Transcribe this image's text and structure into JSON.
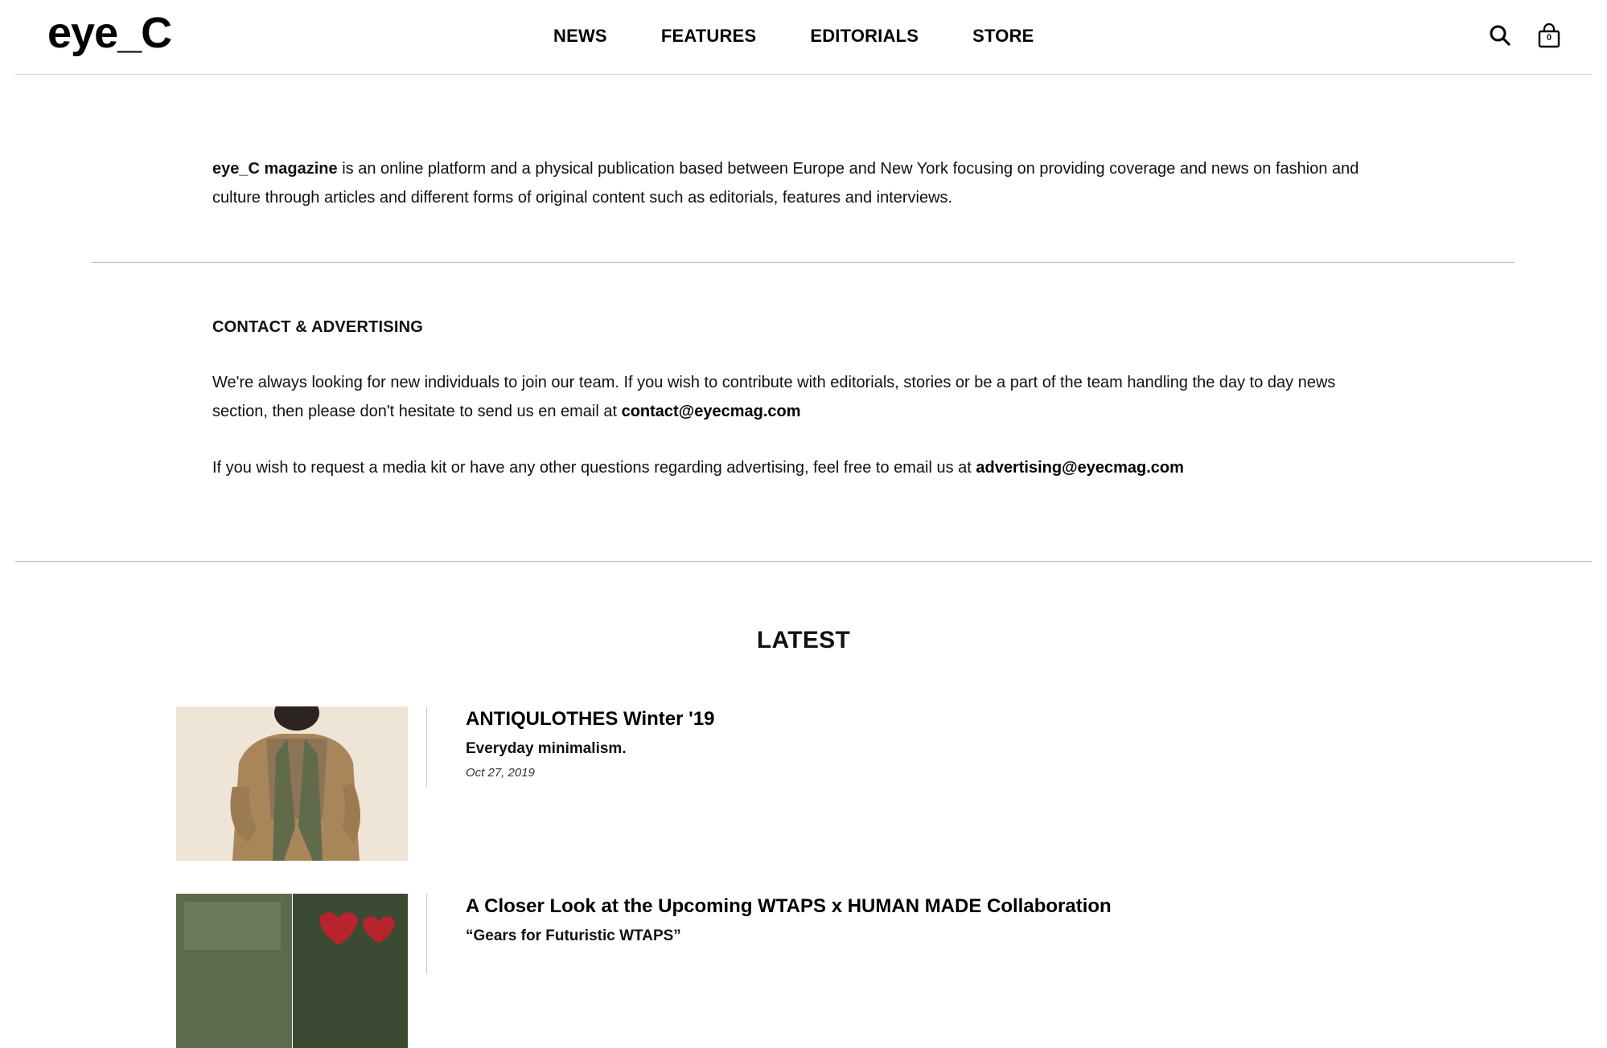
{
  "header": {
    "logo": "eye_C",
    "nav": [
      "NEWS",
      "FEATURES",
      "EDITORIALS",
      "STORE"
    ],
    "search_icon": "search-icon",
    "bag_icon": "shopping-bag-icon",
    "bag_count": "0"
  },
  "about": {
    "brand": "eye_C magazine",
    "text": " is an online platform and a physical publication based between Europe and New York focusing on providing coverage and news on fashion and culture through articles and different forms of original content such as editorials, features and interviews."
  },
  "contact": {
    "title": "CONTACT & ADVERTISING",
    "p1_text": "We're always looking for new individuals to join our team. If you wish to contribute with editorials, stories or be a part of the team handling the day to day news section, then please don't hesitate to send us en email at ",
    "p1_email": "contact@eyecmag.com",
    "p2_text": "If you wish to request a media kit or have any other questions regarding advertising, feel free to email us at ",
    "p2_email": "advertising@eyecmag.com"
  },
  "latest": {
    "title": "LATEST",
    "articles": [
      {
        "title": "ANTIQULOTHES Winter '19",
        "subtitle": "Everyday minimalism.",
        "date": "Oct 27, 2019"
      },
      {
        "title": "A Closer Look at the Upcoming WTAPS x HUMAN MADE Collaboration",
        "subtitle": "“Gears for Futuristic WTAPS”"
      }
    ]
  },
  "colors": {
    "text": "#111111",
    "rule": "#bdbdbd",
    "background": "#ffffff"
  }
}
